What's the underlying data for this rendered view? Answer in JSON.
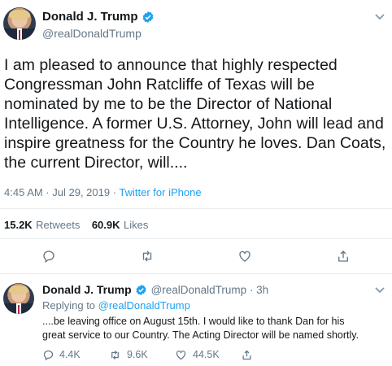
{
  "main_tweet": {
    "author_name": "Donald J. Trump",
    "author_handle": "@realDonaldTrump",
    "text": "I am pleased to announce that highly respected Congressman John Ratcliffe of Texas will be nominated by me to be the Director of National Intelligence. A former U.S. Attorney, John will lead and inspire greatness for the Country he loves. Dan Coats, the current Director, will....",
    "timestamp": "4:45 AM · Jul 29, 2019 · ",
    "source": "Twitter for iPhone",
    "retweets_count": "15.2K",
    "retweets_label": "Retweets",
    "likes_count": "60.9K",
    "likes_label": "Likes",
    "actions": [
      "reply-icon",
      "retweet-icon",
      "like-icon",
      "share-icon"
    ]
  },
  "reply_tweet": {
    "author_name": "Donald J. Trump",
    "handle_and_time": "@realDonaldTrump · 3h",
    "replying_to_label": "Replying to ",
    "replying_to_handle": "@realDonaldTrump",
    "text_line1": "....be leaving office on August 15th. I would like to thank Dan for his",
    "text_line2": "great service to our Country. The Acting Director will be named shortly.",
    "reply_count": "4.4K",
    "retweet_count": "9.6K",
    "like_count": "44.5K"
  },
  "colors": {
    "link": "#1da1f2",
    "secondary": "#657786",
    "divider": "#e6ecf0"
  }
}
